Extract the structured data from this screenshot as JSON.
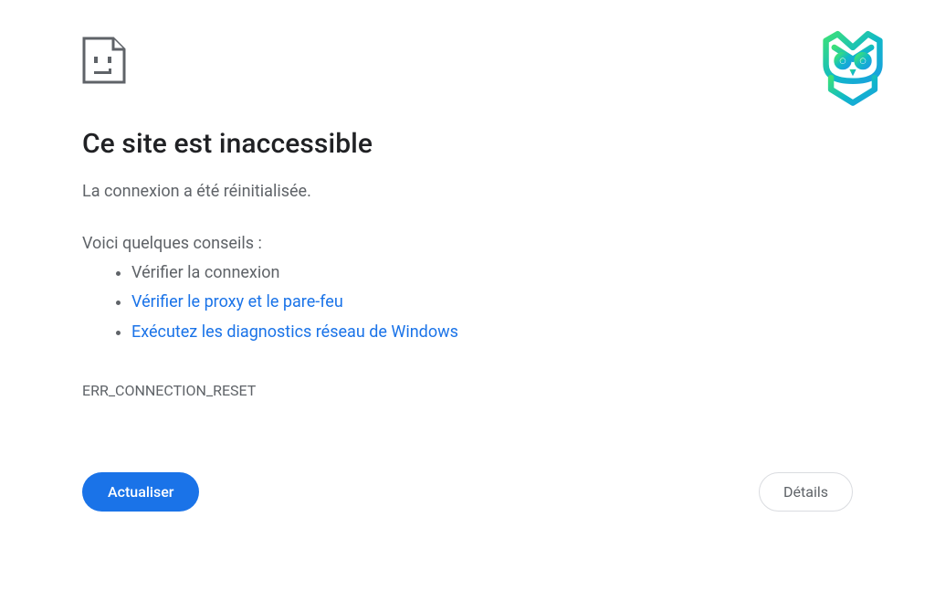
{
  "title": "Ce site est inaccessible",
  "subtitle": "La connexion a été réinitialisée.",
  "tips_intro": "Voici quelques conseils :",
  "tips": [
    {
      "text": "Vérifier la connexion",
      "link": false
    },
    {
      "text": "Vérifier le proxy et le pare-feu",
      "link": true
    },
    {
      "text": "Exécutez les diagnostics réseau de Windows",
      "link": true
    }
  ],
  "error_code": "ERR_CONNECTION_RESET",
  "buttons": {
    "refresh": "Actualiser",
    "details": "Détails"
  },
  "colors": {
    "link": "#1a73e8",
    "primary": "#1a73e8",
    "muted": "#5f6368"
  }
}
